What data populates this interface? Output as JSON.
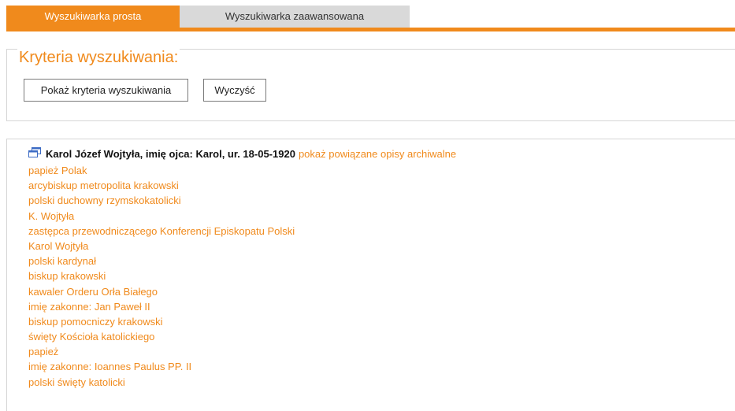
{
  "tabs": {
    "simple": "Wyszukiwarka prosta",
    "advanced": "Wyszukiwarka zaawansowana"
  },
  "criteria": {
    "legend": "Kryteria wyszukiwania:",
    "show_button": "Pokaż kryteria wyszukiwania",
    "clear_button": "Wyczyść"
  },
  "result": {
    "icon": "window-icon",
    "title": "Karol Józef Wojtyła, imię ojca: Karol, ur. 18-05-1920",
    "related_link": "pokaż powiązane opisy archiwalne",
    "aliases": [
      "papież Polak",
      "arcybiskup metropolita krakowski",
      "polski duchowny rzymskokatolicki",
      "K. Wojtyła",
      "zastępca przewodniczącego Konferencji Episkopatu Polski",
      "Karol Wojtyła",
      "polski kardynał",
      "biskup krakowski",
      "kawaler Orderu Orła Białego",
      "imię zakonne: Jan Paweł II",
      "biskup pomocniczy krakowski",
      "święty Kościoła katolickiego",
      "papież",
      "imię zakonne: Ioannes Paulus PP. II",
      "polski święty katolicki"
    ]
  },
  "colors": {
    "accent": "#f08a1c",
    "inactive_tab": "#d9d9d9",
    "border": "#d6d6d6"
  }
}
